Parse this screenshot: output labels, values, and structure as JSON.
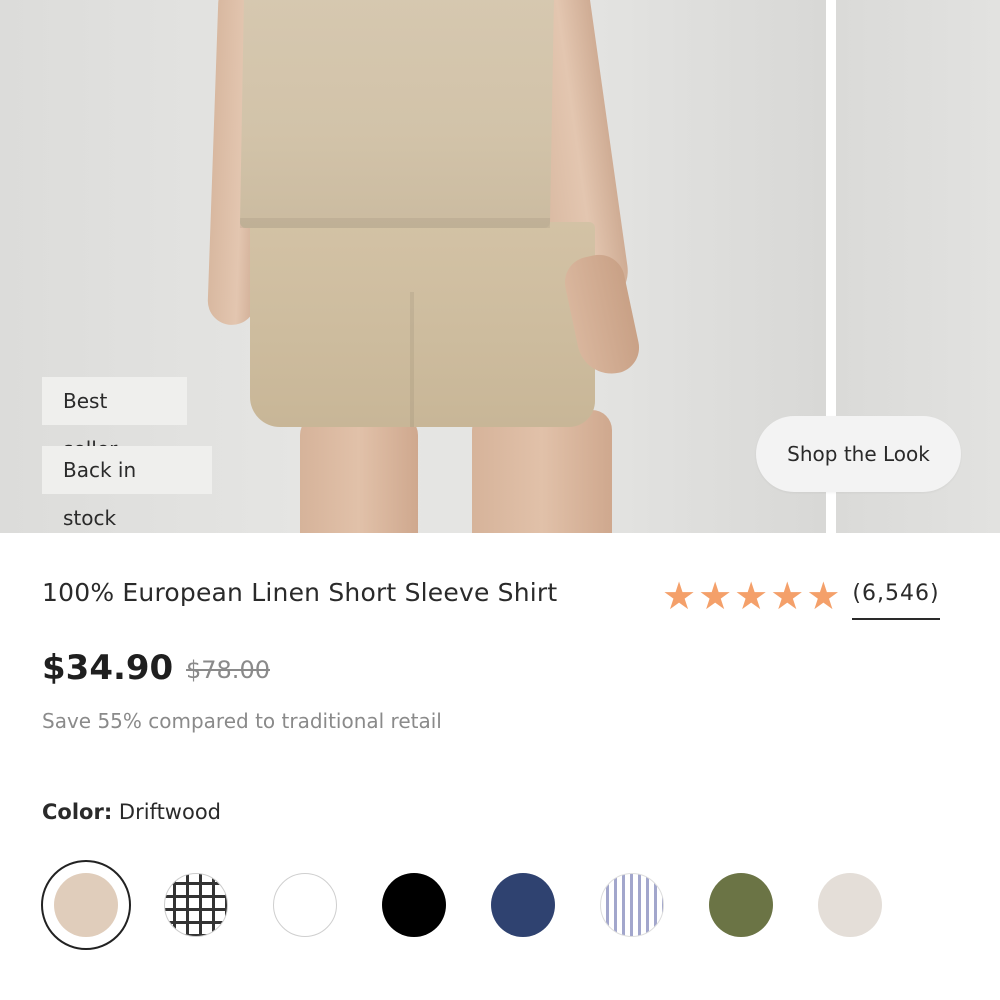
{
  "hero": {
    "badges": [
      "Best seller",
      "Back in stock"
    ],
    "shop_look_label": "Shop the Look"
  },
  "product": {
    "title": "100% European Linen Short Sleeve Shirt",
    "rating": 5,
    "review_count": "(6,546)",
    "price": "$34.90",
    "original_price": "$78.00",
    "savings_text": "Save 55% compared to traditional retail"
  },
  "color": {
    "label": "Color:",
    "selected": "Driftwood",
    "swatches": [
      {
        "color": "#e0cdbb",
        "pattern": "solid",
        "selected": true
      },
      {
        "color": "#ffffff",
        "pattern": "windowpane"
      },
      {
        "color": "#ffffff",
        "pattern": "solid"
      },
      {
        "color": "#000000",
        "pattern": "solid"
      },
      {
        "color": "#2f4270",
        "pattern": "solid"
      },
      {
        "color": "#a2a6cc",
        "pattern": "stripe"
      },
      {
        "color": "#6b7445",
        "pattern": "solid"
      },
      {
        "color": "#e4ded8",
        "pattern": "solid"
      }
    ]
  },
  "colors": {
    "star": "#f4a06a",
    "badge_bg": "#efefed",
    "text_muted": "#8a8a8a"
  }
}
